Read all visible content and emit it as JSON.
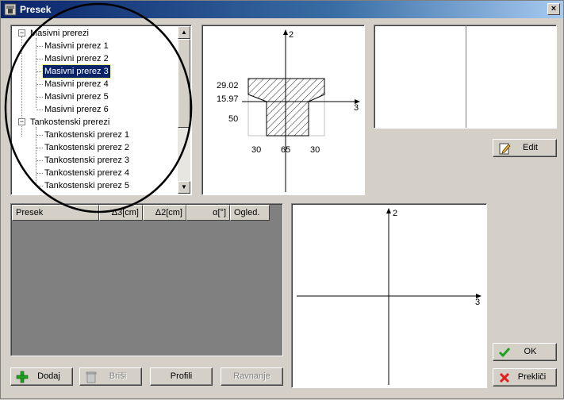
{
  "window": {
    "title": "Presek",
    "close_glyph": "×"
  },
  "tree": {
    "groups": [
      {
        "label": "Masivni prerezi",
        "toggle": "−",
        "items": [
          "Masivni prerez 1",
          "Masivni prerez 2",
          "Masivni prerez 3",
          "Masivni prerez 4",
          "Masivni prerez 5",
          "Masivni prerez 6"
        ]
      },
      {
        "label": "Tankostenski prerezi",
        "toggle": "−",
        "items": [
          "Tankostenski prerez 1",
          "Tankostenski prerez 2",
          "Tankostenski prerez 3",
          "Tankostenski prerez 4",
          "Tankostenski prerez 5"
        ]
      }
    ],
    "selected": "Masivni prerez 3"
  },
  "preview": {
    "axis_v": "2",
    "axis_h": "3",
    "dim_left_top": "29.02",
    "dim_left_mid": "15.97",
    "dim_left_low": "50",
    "dim_bottom_left": "30",
    "dim_bottom_mid": "65",
    "dim_bottom_right": "30"
  },
  "table": {
    "columns": [
      "Presek",
      "Δ3[cm]",
      "Δ2[cm]",
      "α[°]",
      "Ogled."
    ]
  },
  "axes2": {
    "axis_v": "2",
    "axis_h": "3"
  },
  "buttons": {
    "edit": "Edit",
    "add": "Dodaj",
    "delete": "Briši",
    "profiles": "Profili",
    "align": "Ravnanje",
    "ok": "OK",
    "cancel": "Prekliči"
  },
  "colors": {
    "title_start": "#0a246a",
    "title_end": "#a6caf0",
    "selection": "#0a246a",
    "face": "#d4d0c8"
  }
}
